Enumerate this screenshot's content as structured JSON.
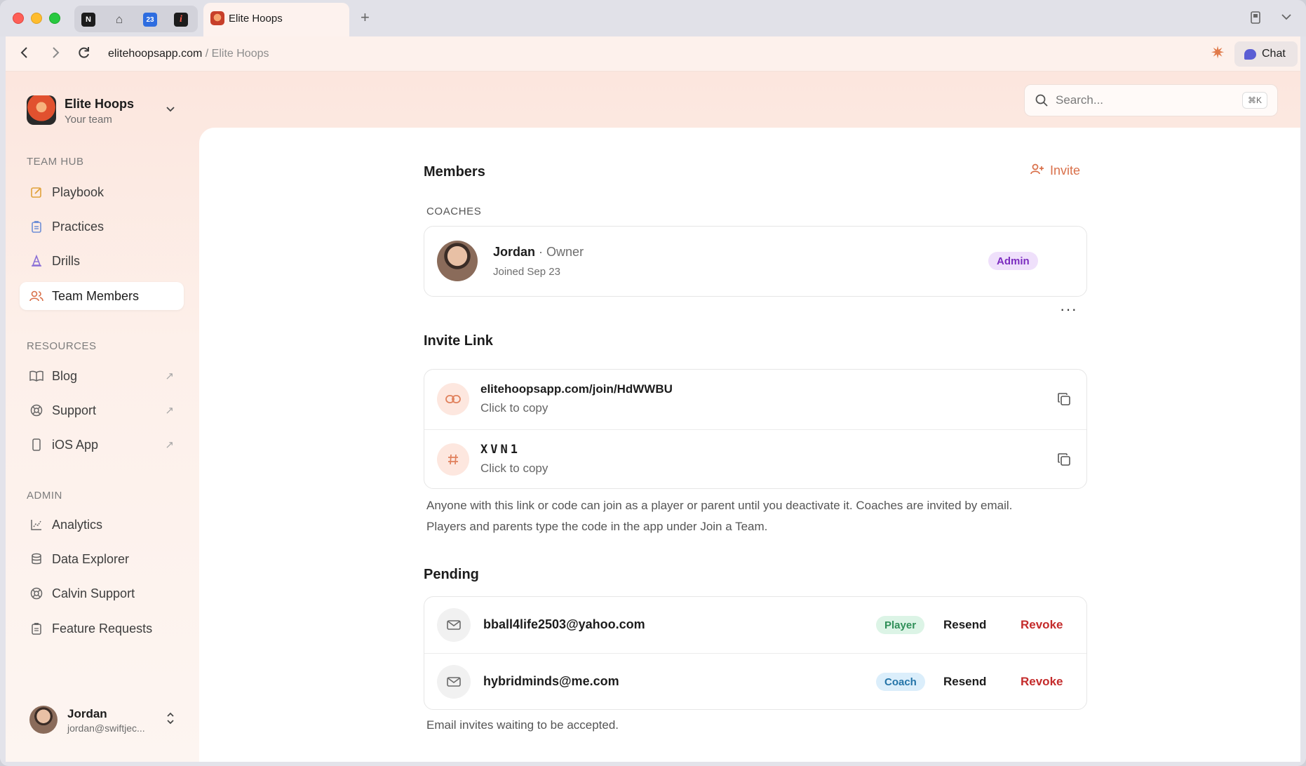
{
  "browser": {
    "tab_title": "Elite Hoops",
    "pinned_calendar_day": "23",
    "url_domain": "elitehoopsapp.com",
    "url_separator": "/",
    "url_page": "Elite Hoops",
    "chat_label": "Chat"
  },
  "team": {
    "name": "Elite Hoops",
    "subtitle": "Your team"
  },
  "sidebar": {
    "team_hub_label": "TEAM HUB",
    "team_hub": [
      {
        "label": "Playbook",
        "icon": "pencil-square-icon"
      },
      {
        "label": "Practices",
        "icon": "clipboard-icon"
      },
      {
        "label": "Drills",
        "icon": "cone-icon"
      },
      {
        "label": "Team Members",
        "icon": "users-icon",
        "active": true
      }
    ],
    "resources_label": "RESOURCES",
    "resources": [
      {
        "label": "Blog",
        "icon": "book-icon",
        "external": "↗"
      },
      {
        "label": "Support",
        "icon": "lifebuoy-icon",
        "external": "↗"
      },
      {
        "label": "iOS App",
        "icon": "phone-icon",
        "external": "↗"
      }
    ],
    "admin_label": "ADMIN",
    "admin": [
      {
        "label": "Analytics",
        "icon": "chart-icon"
      },
      {
        "label": "Data Explorer",
        "icon": "database-icon"
      },
      {
        "label": "Calvin Support",
        "icon": "lifebuoy-icon"
      },
      {
        "label": "Feature Requests",
        "icon": "clipboard-icon"
      }
    ]
  },
  "user": {
    "name": "Jordan",
    "email": "jordan@swiftjec..."
  },
  "search": {
    "placeholder": "Search...",
    "shortcut": "⌘K"
  },
  "members": {
    "title": "Members",
    "invite_label": "Invite",
    "coaches_label": "COACHES",
    "coach": {
      "name": "Jordan",
      "separator": "·",
      "role": "Owner",
      "joined": "Joined Sep 23",
      "badge": "Admin"
    }
  },
  "invite_link": {
    "title": "Invite Link",
    "more": "···",
    "link": "elitehoopsapp.com/join/HdWWBU",
    "link_hint": "Click to copy",
    "code": "XVN1",
    "code_hint": "Click to copy",
    "note_line1": "Anyone with this link or code can join as a player or parent until you deactivate it. Coaches are invited by email.",
    "note_line2": "Players and parents type the code in the app under Join a Team."
  },
  "pending": {
    "title": "Pending",
    "items": [
      {
        "email": "bball4life2503@yahoo.com",
        "role": "Player",
        "resend": "Resend",
        "revoke": "Revoke"
      },
      {
        "email": "hybridminds@me.com",
        "role": "Coach",
        "resend": "Resend",
        "revoke": "Revoke"
      }
    ],
    "note": "Email invites waiting to be accepted."
  },
  "colors": {
    "accent": "#d9704a",
    "revoke": "#c42b2b",
    "admin_badge": "#7b2cbf",
    "player_badge": "#2f8f58",
    "coach_badge": "#2474a8"
  }
}
